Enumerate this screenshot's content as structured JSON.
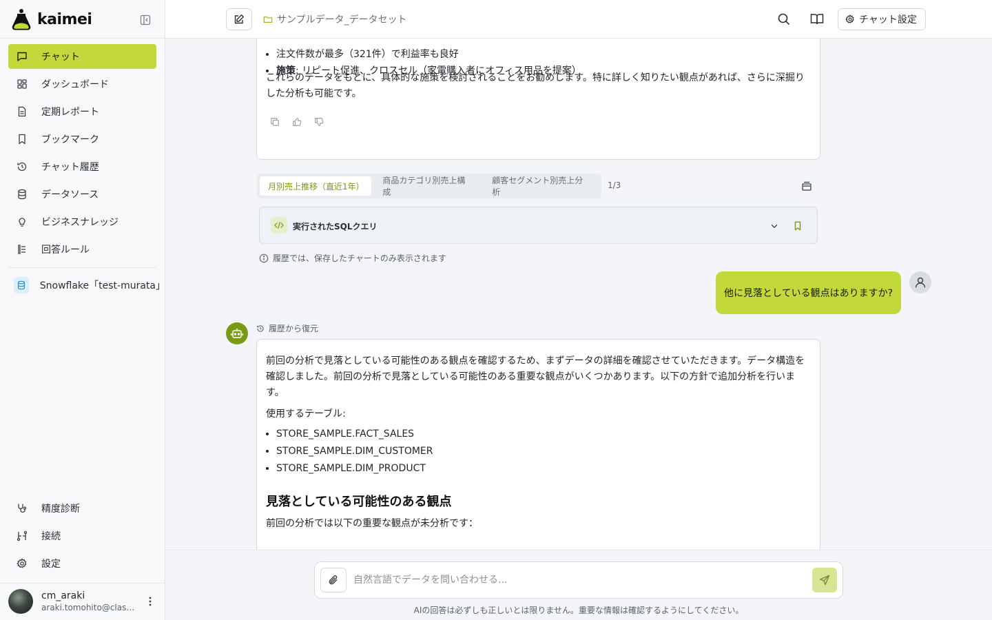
{
  "app": {
    "name": "kaimei"
  },
  "sidebar": {
    "items": [
      {
        "label": "チャット",
        "icon": "chat-icon",
        "active": true
      },
      {
        "label": "ダッシュボード",
        "icon": "dashboard-icon"
      },
      {
        "label": "定期レポート",
        "icon": "report-icon"
      },
      {
        "label": "ブックマーク",
        "icon": "bookmark-icon"
      },
      {
        "label": "チャット履歴",
        "icon": "history-icon"
      },
      {
        "label": "データソース",
        "icon": "database-icon"
      },
      {
        "label": "ビジネスナレッジ",
        "icon": "lightbulb-icon"
      },
      {
        "label": "回答ルール",
        "icon": "rules-icon"
      }
    ],
    "datasource": "Snowflake「test-murata」",
    "bottom_items": [
      {
        "label": "精度診断",
        "icon": "stethoscope-icon"
      },
      {
        "label": "接続",
        "icon": "connection-icon"
      },
      {
        "label": "設定",
        "icon": "gear-icon"
      }
    ],
    "user": {
      "name": "cm_araki",
      "email": "araki.tomohito@classmethod.jp"
    }
  },
  "header": {
    "dataset": "サンプルデータ_データセット",
    "chat_settings": "チャット設定"
  },
  "message1": {
    "bullets": [
      {
        "bold": "",
        "text": "注文件数が最多（321件）で利益率も良好"
      },
      {
        "bold": "施策",
        "text": ": リピート促進、クロスセル（家電購入者にオフィス用品を提案）"
      }
    ],
    "paragraph": "これらのデータをもとに、具体的な施策を検討されることをお勧めします。特に詳しく知りたい観点があれば、さらに深掘りした分析も可能です。"
  },
  "chart_tabs": {
    "tabs": [
      "月別売上推移（直近1年）",
      "商品カテゴリ別売上構成",
      "顧客セグメント別売上分析"
    ],
    "count": "1/3"
  },
  "sql_panel": {
    "label": "実行されたSQLクエリ"
  },
  "history_note": "履歴では、保存したチャートのみ表示されます",
  "user_message": "他に見落としている観点はありますか?",
  "restored_label": "履歴から復元",
  "message2": {
    "p1": "前回の分析で見落としている可能性のある観点を確認するため、まずデータの詳細を確認させていただきます。データ構造を確認しました。前回の分析で見落としている可能性のある重要な観点がいくつかあります。以下の方針で追加分析を行います。",
    "p2": "使用するテーブル:",
    "tables": [
      "STORE_SAMPLE.FACT_SALES",
      "STORE_SAMPLE.DIM_CUSTOMER",
      "STORE_SAMPLE.DIM_PRODUCT"
    ],
    "heading": "見落としている可能性のある観点",
    "p3": "前回の分析では以下の重要な観点が未分析です："
  },
  "composer": {
    "placeholder": "自然言語でデータを問い合わせる...",
    "disclaimer": "AIの回答は必ずしも正しいとは限りません。重要な情報は確認するようにしてください。"
  },
  "colors": {
    "accent": "#c3d83a",
    "accent_dark": "#7a9a14"
  }
}
